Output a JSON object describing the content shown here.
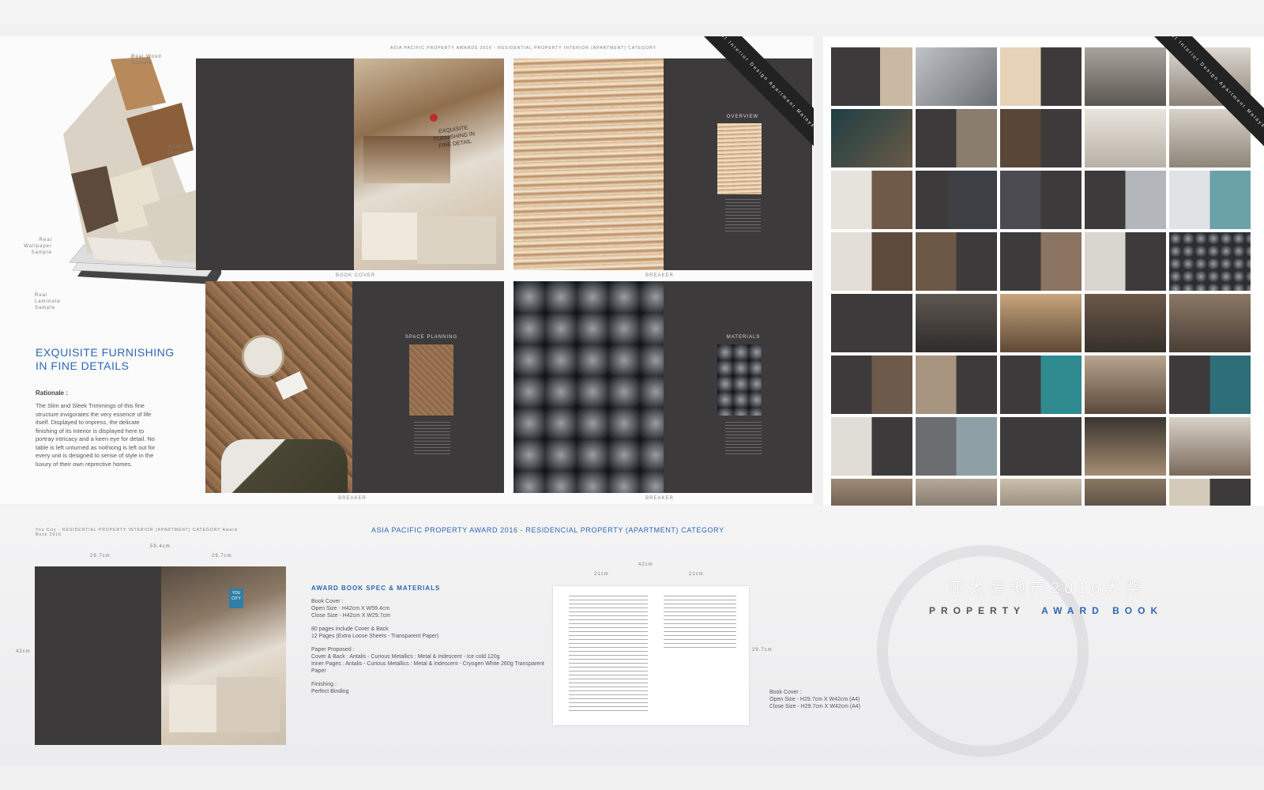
{
  "main": {
    "header_strip": "ASIA PACIFIC PROPERTY AWARDS 2016 - RESIDENTIAL PROPERTY INTERIOR (APARTMENT) CATEGORY",
    "book_labels": {
      "wood": "Real Wood Sample",
      "tape": "Masking Tape",
      "wallpaper": "Real Wallpaper Sample",
      "laminate": "Real Laminate Sample"
    },
    "headline": "EXQUISITE FURNISHING IN FINE DETAILS",
    "rationale_label": "Rationale :",
    "rationale_text": "The Slim and Sleek Trimmings of this fine structure invigorates the very essence of life itself. Displayed to impress, the delicate finishing of its interior is displayed here to portray intricacy and a keen eye for detail. No table is left unturned as nothiong is left out for every unit is designed to sense of style in the luxury of their own reprective homes.",
    "cover_title": "EXQUISITE FURNISHING IN FINE DETAIL",
    "spread_captions": [
      "BOOK COVER",
      "BREAKER",
      "BREAKER",
      "BREAKER"
    ],
    "section_titles": [
      "OVERVIEW",
      "SPACE PLANNING",
      "MATERIALS"
    ],
    "ribbon_text": "Best Interior Design Apartment Malaysia 2016",
    "award_banner": "ASIA PACIFIC PROPERTY AWARD 2016 - RESIDENCIAL PROPERTY (APARTMENT) CATEGORY",
    "small_caption": "You City - RESIDENTIAL PROPERTY INTERIOR (APARTMENT) CATEGORY Award Book 2016"
  },
  "dimensions": {
    "w594": "59.4cm",
    "w297a": "29.7cm",
    "w297b": "29.7cm",
    "h42": "42cm",
    "w42": "42cm",
    "w21a": "21cm",
    "w21b": "21cm",
    "h297": "29.7cm"
  },
  "spec": {
    "title": "AWARD BOOK SPEC & MATERIALS",
    "items": [
      {
        "a": "Book Cover :",
        "b": "Open Size - H42cm X W59.4cm",
        "c": "Close Size - H42cm X W29.7cm"
      },
      {
        "a": "80 pages include Cover & Back",
        "b": "12 Pages (Extra Loose Sheets - Transparent Paper)",
        "c": ""
      },
      {
        "a": "Paper Proposed :",
        "b": "Cover & Back : Antalis - Curious Metallics : Metal & Iridescent - Ice cold 120g",
        "c": "Inner Pages : Antalis - Curious Metallics : Metal & Iridescent - Cryogen White 260g Transparent Paper"
      },
      {
        "a": "Finishing :",
        "b": "Perfect Binding",
        "c": ""
      }
    ],
    "cover2_a": "Book Cover :",
    "cover2_b": "Open Size - H29.7cm X W42cm (A4)",
    "cover2_c": "Close Size - H29.7cm X W42cm (A4)"
  },
  "you_city": "YOU CITY",
  "branding": {
    "chinese_title": "亚太房地产2016大奖",
    "word1": "PROPERTY",
    "word2": "AWARD BOOK"
  },
  "colors": {
    "accent_blue": "#2c67b3",
    "dark_page": "#3c3a3b",
    "background": "#f1f1f2"
  }
}
